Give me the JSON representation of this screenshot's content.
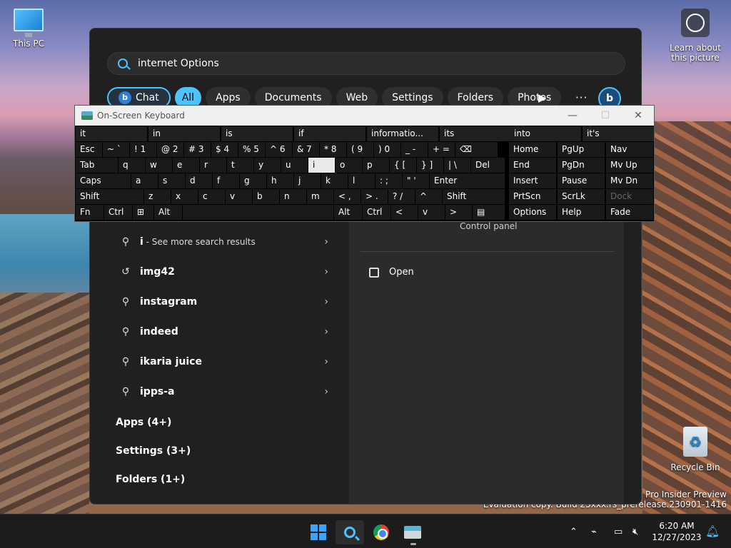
{
  "desktop": {
    "this_pc": "This PC",
    "learn_about": "Learn about this picture",
    "recycle_bin": "Recycle Bin",
    "watermark_line1": "11 Pro Insider Preview",
    "watermark_line2": "Evaluation copy. Build 25xxx.rs_prerelease.230901-1416"
  },
  "search": {
    "query": "internet Options",
    "filters": [
      "All",
      "Apps",
      "Documents",
      "Web",
      "Settings",
      "Folders",
      "Photos"
    ],
    "chat_label": "Chat",
    "more": "···",
    "results": [
      {
        "text": "i",
        "sub": " - See more search results",
        "icon": "search-icon"
      },
      {
        "text": "img42",
        "sub": "",
        "icon": "history-icon"
      },
      {
        "text": "instagram",
        "sub": "",
        "icon": "search-icon"
      },
      {
        "text": "indeed",
        "sub": "",
        "icon": "search-icon"
      },
      {
        "text": "ikaria juice",
        "sub": "",
        "icon": "search-icon"
      },
      {
        "text": "ipps-a",
        "sub": "",
        "icon": "search-icon"
      }
    ],
    "sections": [
      "Apps (4+)",
      "Settings (3+)",
      "Folders (1+)"
    ],
    "preview": {
      "subtitle": "Control panel",
      "open": "Open"
    }
  },
  "osk": {
    "title": "On-Screen Keyboard",
    "predictions": [
      "it",
      "in",
      "is",
      "if",
      "informatio...",
      "its",
      "into",
      "it's"
    ],
    "row1": [
      "Esc",
      "~ `",
      "! 1",
      "@ 2",
      "# 3",
      "$ 4",
      "% 5",
      "^ 6",
      "& 7",
      "* 8",
      "( 9",
      ") 0",
      "_ -",
      "+ =",
      "⌫"
    ],
    "row2": [
      "Tab",
      "q",
      "w",
      "e",
      "r",
      "t",
      "y",
      "u",
      "i",
      "o",
      "p",
      "{ [",
      "} ]",
      "| \\",
      "Del"
    ],
    "row3": [
      "Caps",
      "a",
      "s",
      "d",
      "f",
      "g",
      "h",
      "j",
      "k",
      "l",
      ": ;",
      "\" '",
      "Enter"
    ],
    "row4": [
      "Shift",
      "z",
      "x",
      "c",
      "v",
      "b",
      "n",
      "m",
      "< ,",
      "> .",
      "? /",
      "^",
      "Shift"
    ],
    "row5": [
      "Fn",
      "Ctrl",
      "⊞",
      "Alt",
      "",
      "Alt",
      "Ctrl",
      "<",
      "v",
      ">",
      "▤"
    ],
    "nav": [
      [
        "Home",
        "PgUp",
        "Nav"
      ],
      [
        "End",
        "PgDn",
        "Mv Up"
      ],
      [
        "Insert",
        "Pause",
        "Mv Dn"
      ],
      [
        "PrtScn",
        "ScrLk",
        "Dock"
      ],
      [
        "Options",
        "Help",
        "Fade"
      ]
    ]
  },
  "taskbar": {
    "time": "6:20 AM",
    "date": "12/27/2023"
  }
}
